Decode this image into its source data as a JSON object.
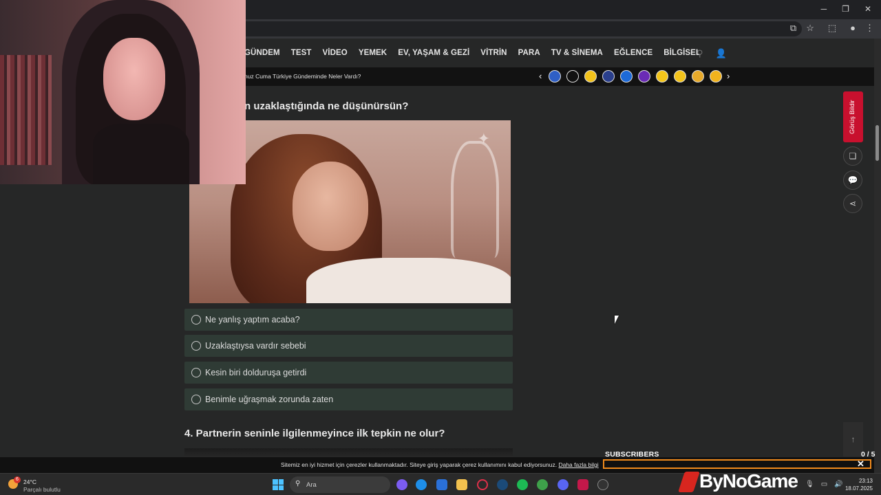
{
  "site": {
    "nav": [
      "GÜNDEM",
      "TEST",
      "VİDEO",
      "YEMEK",
      "EV, YAŞAM & GEZİ",
      "VİTRİN",
      "PARA",
      "TV & SİNEMA",
      "EĞLENCE",
      "BİLGİSEL"
    ],
    "ticker_text": "nuz Cuma Türkiye Gündeminde Neler Vardı?",
    "ticker_prev": "‹",
    "ticker_next": "›",
    "badge_colors": [
      "#2f5fc5",
      "#111111",
      "#f2c21b",
      "#2a3f8c",
      "#1d6ad8",
      "#6a2bb5",
      "#f3c51a",
      "#f2c21b",
      "#e6a92a",
      "#f2b31d"
    ]
  },
  "quiz": {
    "question3": "n uzaklaştığında ne düşünürsün?",
    "options": [
      "Ne yanlış yaptım acaba?",
      "Uzaklaştıysa vardır sebebi",
      "Kesin biri dolduruşa getirdi",
      "Benimle uğraşmak zorunda zaten"
    ],
    "question4": "4. Partnerin seninle ilgilenmeyince ilk tepkin ne olur?"
  },
  "rail": {
    "feedback_label": "Görüş Bildir"
  },
  "cookie": {
    "text": "Sitemiz en iyi hizmet için çerezler kullanmaktadır. Siteye giriş yaparak çerez kullanımını kabul ediyorsunuz.",
    "link": "Daha fazla bilgi"
  },
  "subscribers": {
    "label": "SUBSCRIBERS",
    "count": "0 / 5",
    "current": 0,
    "goal": 5
  },
  "taskbar": {
    "weather_badge": "6",
    "weather_temp": "24°C",
    "weather_desc": "Parçalı bulutlu",
    "search_placeholder": "Ara",
    "brand": "ByNoGame",
    "time": "23:13",
    "date": "18.07.2025"
  },
  "colors": {
    "accent_red": "#c8102e",
    "subs_border": "#f08a1c",
    "option_bg": "#2f3b35"
  }
}
